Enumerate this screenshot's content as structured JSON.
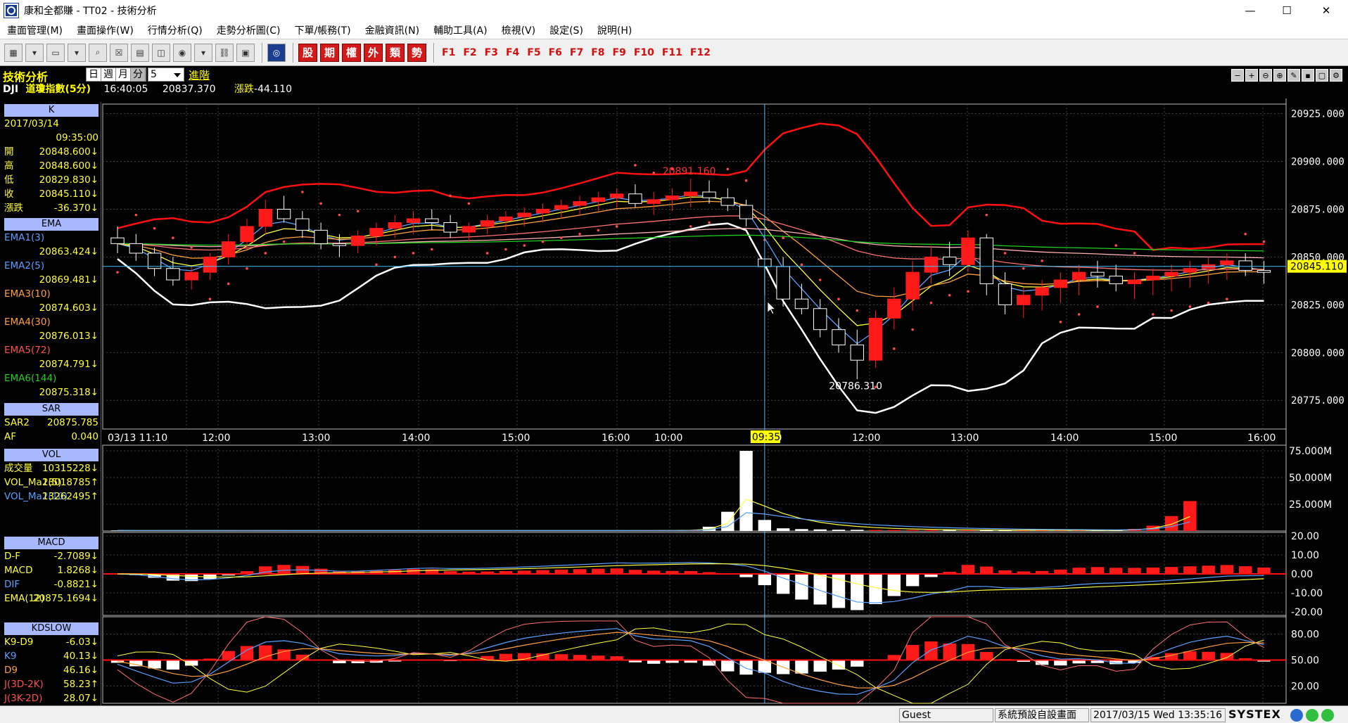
{
  "window": {
    "title": "康和全都賺 - TT02 - 技術分析",
    "minimize": "—",
    "maximize": "☐",
    "close": "✕"
  },
  "menu": [
    "畫面管理(M)",
    "畫面操作(W)",
    "行情分析(Q)",
    "走勢分析圖(C)",
    "下單/帳務(T)",
    "金融資訊(N)",
    "輔助工具(A)",
    "檢視(V)",
    "設定(S)",
    "說明(H)"
  ],
  "toolbar": {
    "red_buttons": [
      "股",
      "期",
      "權",
      "外",
      "類",
      "勢"
    ],
    "function_keys": [
      "F1",
      "F2",
      "F3",
      "F4",
      "F5",
      "F6",
      "F7",
      "F8",
      "F9",
      "F10",
      "F11",
      "F12"
    ]
  },
  "header": {
    "title": "技術分析",
    "periods": [
      "日",
      "週",
      "月",
      "分"
    ],
    "active_period": "分",
    "period_value": "5",
    "advanced": "進階",
    "symbol": "DJI",
    "name": "道瓊指數(5分)",
    "time": "16:40:05",
    "price": "20837.370",
    "change_label": "漲跌",
    "change": "-44.110"
  },
  "left_panel": {
    "k": {
      "title": "K",
      "date": "2017/03/14",
      "time": "09:35:00",
      "rows": [
        {
          "label": "開",
          "value": "20848.600↓"
        },
        {
          "label": "高",
          "value": "20848.600↓"
        },
        {
          "label": "低",
          "value": "20829.830↓"
        },
        {
          "label": "收",
          "value": "20845.110↓"
        },
        {
          "label": "漲跌",
          "value": "-36.370↓"
        }
      ]
    },
    "ema": {
      "title": "EMA",
      "rows": [
        {
          "label": "EMA1(3)",
          "value": "20863.424↓"
        },
        {
          "label": "EMA2(5)",
          "value": "20869.481↓"
        },
        {
          "label": "EMA3(10)",
          "value": "20874.603↓"
        },
        {
          "label": "EMA4(30)",
          "value": "20876.013↓"
        },
        {
          "label": "EMA5(72)",
          "value": "20874.791↓"
        },
        {
          "label": "EMA6(144)",
          "value": "20875.318↓"
        }
      ]
    },
    "sar": {
      "title": "SAR",
      "rows": [
        {
          "label": "SAR2",
          "value": "20875.785"
        },
        {
          "label": "AF",
          "value": "0.040"
        }
      ]
    },
    "vol": {
      "title": "VOL",
      "rows": [
        {
          "label": "成交量",
          "value": "10315228↓"
        },
        {
          "label": "VOL_Ma1(5)",
          "value": "23018785↑"
        },
        {
          "label": "VOL_Ma2(10)",
          "value": "13262495↑"
        }
      ]
    },
    "macd": {
      "title": "MACD",
      "rows": [
        {
          "label": "D-F",
          "value": "-2.7089↓"
        },
        {
          "label": "MACD",
          "value": "1.8268↓"
        },
        {
          "label": "DIF",
          "value": "-0.8821↓"
        },
        {
          "label": "EMA(12)",
          "value": "20875.1694↓"
        }
      ]
    },
    "kd": {
      "title": "KDSLOW",
      "rows": [
        {
          "label": "K9-D9",
          "value": "-6.03↓"
        },
        {
          "label": "K9",
          "value": "40.13↓"
        },
        {
          "label": "D9",
          "value": "46.16↓"
        },
        {
          "label": "J(3D-2K)",
          "value": "58.23↑"
        },
        {
          "label": "J(3K-2D)",
          "value": "28.07↓"
        }
      ]
    }
  },
  "colors": {
    "up": "#ff1a1a",
    "down": "#ffffff",
    "sar": "#ff4a4a",
    "bb_upper": "#ff1010",
    "bb_lower": "#ffffff",
    "ema1": "#5aa0ff",
    "ema2": "#ffff40",
    "ema3": "#ffa040",
    "ema4": "#ff7070",
    "ema5": "#ffb0b0",
    "ema6": "#20d020",
    "crosshair": "#40c0ff",
    "panel_header": "#a8b8ff",
    "cursor_price_bg": "#ffff00"
  },
  "chart_data": {
    "type": "candlestick",
    "price_axis": {
      "ticks": [
        "20925.000",
        "20900.000",
        "20875.000",
        "20850.000",
        "20825.000",
        "20800.000",
        "20775.000"
      ],
      "range": [
        20760,
        20930
      ]
    },
    "cursor_price": "20845.110",
    "cursor_time": "09:35",
    "high_label": "20891.160",
    "low_label": "20786.310",
    "time_axis": [
      "03/13 11:10",
      "12:00",
      "13:00",
      "14:00",
      "15:00",
      "16:00",
      "10:00",
      "11:00",
      "12:00",
      "13:00",
      "14:00",
      "15:00",
      "16:00"
    ],
    "candles": [
      [
        20860,
        20866,
        20852,
        20857
      ],
      [
        20857,
        20862,
        20848,
        20852
      ],
      [
        20852,
        20855,
        20840,
        20844
      ],
      [
        20844,
        20850,
        20835,
        20838
      ],
      [
        20838,
        20845,
        20833,
        20842
      ],
      [
        20842,
        20852,
        20838,
        20850
      ],
      [
        20850,
        20862,
        20846,
        20858
      ],
      [
        20858,
        20870,
        20854,
        20866
      ],
      [
        20866,
        20880,
        20862,
        20875
      ],
      [
        20875,
        20882,
        20868,
        20870
      ],
      [
        20870,
        20874,
        20860,
        20864
      ],
      [
        20864,
        20868,
        20854,
        20857
      ],
      [
        20857,
        20862,
        20850,
        20856
      ],
      [
        20856,
        20864,
        20852,
        20861
      ],
      [
        20861,
        20868,
        20856,
        20865
      ],
      [
        20865,
        20872,
        20860,
        20868
      ],
      [
        20868,
        20874,
        20862,
        20870
      ],
      [
        20870,
        20875,
        20864,
        20868
      ],
      [
        20868,
        20872,
        20860,
        20863
      ],
      [
        20863,
        20868,
        20858,
        20866
      ],
      [
        20866,
        20872,
        20862,
        20869
      ],
      [
        20869,
        20874,
        20864,
        20871
      ],
      [
        20871,
        20876,
        20866,
        20873
      ],
      [
        20873,
        20878,
        20868,
        20875
      ],
      [
        20875,
        20880,
        20870,
        20877
      ],
      [
        20877,
        20882,
        20872,
        20879
      ],
      [
        20879,
        20884,
        20874,
        20881
      ],
      [
        20881,
        20886,
        20876,
        20883
      ],
      [
        20883,
        20888,
        20876,
        20878
      ],
      [
        20878,
        20884,
        20872,
        20880
      ],
      [
        20880,
        20886,
        20874,
        20882
      ],
      [
        20882,
        20891,
        20876,
        20884
      ],
      [
        20884,
        20890,
        20878,
        20881
      ],
      [
        20881,
        20886,
        20874,
        20877
      ],
      [
        20877,
        20880,
        20866,
        20870
      ],
      [
        20849,
        20849,
        20830,
        20845
      ],
      [
        20845,
        20850,
        20824,
        20828
      ],
      [
        20828,
        20836,
        20820,
        20823
      ],
      [
        20823,
        20828,
        20808,
        20812
      ],
      [
        20812,
        20818,
        20800,
        20804
      ],
      [
        20804,
        20812,
        20786,
        20796
      ],
      [
        20796,
        20822,
        20792,
        20818
      ],
      [
        20818,
        20834,
        20812,
        20828
      ],
      [
        20828,
        20848,
        20822,
        20842
      ],
      [
        20842,
        20856,
        20836,
        20850
      ],
      [
        20850,
        20858,
        20840,
        20846
      ],
      [
        20846,
        20864,
        20842,
        20860
      ],
      [
        20860,
        20862,
        20830,
        20836
      ],
      [
        20836,
        20842,
        20820,
        20825
      ],
      [
        20825,
        20834,
        20818,
        20830
      ],
      [
        20830,
        20838,
        20822,
        20834
      ],
      [
        20834,
        20842,
        20826,
        20838
      ],
      [
        20838,
        20846,
        20830,
        20842
      ],
      [
        20842,
        20848,
        20834,
        20840
      ],
      [
        20840,
        20846,
        20832,
        20836
      ],
      [
        20836,
        20842,
        20828,
        20838
      ],
      [
        20838,
        20844,
        20830,
        20840
      ],
      [
        20840,
        20846,
        20832,
        20842
      ],
      [
        20842,
        20848,
        20834,
        20844
      ],
      [
        20844,
        20850,
        20836,
        20846
      ],
      [
        20846,
        20852,
        20838,
        20848
      ],
      [
        20848,
        20852,
        20840,
        20843
      ],
      [
        20843,
        20848,
        20836,
        20842
      ]
    ],
    "volume_axis": {
      "ticks": [
        "75.000M",
        "50.000M",
        "25.000M"
      ],
      "range": [
        0,
        75000000
      ]
    },
    "volume": [
      500000,
      400000,
      420000,
      380000,
      410000,
      390000,
      430000,
      450000,
      400000,
      380000,
      410000,
      420000,
      390000,
      400000,
      430000,
      410000,
      390000,
      420000,
      400000,
      410000,
      380000,
      430000,
      420000,
      400000,
      440000,
      410000,
      420000,
      450000,
      480000,
      520000,
      600000,
      900000,
      4000000,
      18000000,
      75000000,
      10315228,
      2500000,
      1800000,
      1500000,
      1200000,
      1100000,
      1000000,
      950000,
      900000,
      870000,
      850000,
      820000,
      800000,
      780000,
      760000,
      740000,
      720000,
      700000,
      690000,
      680000,
      2000000,
      5000000,
      14000000,
      28000000
    ],
    "macd_axis": {
      "ticks": [
        "20.00",
        "10.00",
        "0.00",
        "-10.00",
        "-20.00"
      ],
      "range": [
        -20,
        20
      ]
    },
    "kd_axis": {
      "ticks": [
        "80.00",
        "50.00",
        "20.00"
      ],
      "range": [
        0,
        100
      ]
    }
  },
  "status": {
    "user": "Guest",
    "page": "系統預設自設畫面",
    "datetime": "2017/03/15 Wed 13:35:16",
    "brand": "SYSTEX"
  }
}
